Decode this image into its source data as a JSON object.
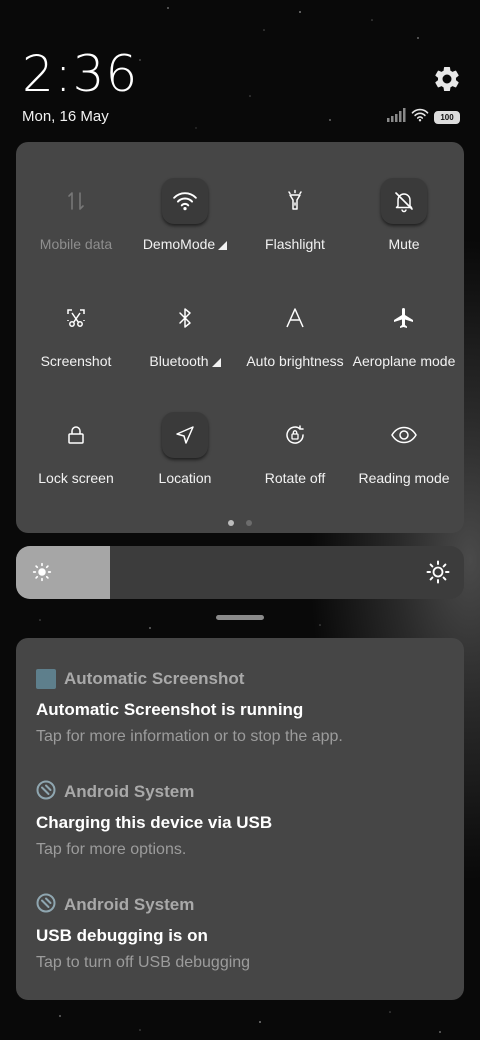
{
  "lockscreen": {
    "time": "2:36",
    "date": "Mon, 16 May",
    "battery": "100"
  },
  "quick_settings": {
    "tiles": [
      {
        "label": "Mobile data",
        "icon": "mobile-data-icon",
        "active": false,
        "disabled": true
      },
      {
        "label": "DemoMode",
        "icon": "wifi-icon",
        "active": true,
        "expandable": true
      },
      {
        "label": "Flashlight",
        "icon": "flashlight-icon",
        "active": false
      },
      {
        "label": "Mute",
        "icon": "bell-off-icon",
        "active": true
      },
      {
        "label": "Screenshot",
        "icon": "screenshot-scissors-icon",
        "active": false
      },
      {
        "label": "Bluetooth",
        "icon": "bluetooth-icon",
        "active": false,
        "expandable": true
      },
      {
        "label": "Auto brightness",
        "icon": "auto-brightness-icon",
        "active": false
      },
      {
        "label": "Aeroplane mode",
        "icon": "airplane-icon",
        "active": false
      },
      {
        "label": "Lock screen",
        "icon": "lock-icon",
        "active": false
      },
      {
        "label": "Location",
        "icon": "location-arrow-icon",
        "active": true
      },
      {
        "label": "Rotate off",
        "icon": "rotation-lock-icon",
        "active": false
      },
      {
        "label": "Reading mode",
        "icon": "eye-icon",
        "active": false
      }
    ],
    "page_count": 2,
    "current_page": 1
  },
  "brightness": {
    "level_fraction": 0.21
  },
  "notifications": [
    {
      "app": "Automatic Screenshot",
      "title": "Automatic Screenshot is running",
      "text": "Tap for more information or to stop the app.",
      "icon": "app-square-icon"
    },
    {
      "app": "Android System",
      "title": "Charging this device via USB",
      "text": "Tap for more options.",
      "icon": "android-system-icon"
    },
    {
      "app": "Android System",
      "title": "USB debugging is on",
      "text": "Tap to turn off USB debugging",
      "icon": "android-system-icon"
    }
  ],
  "colors": {
    "panel": "#464646",
    "active_tile": "#3a3a3a",
    "brightness_fill": "#a6a6a6",
    "app_square": "#5e7f8c"
  }
}
